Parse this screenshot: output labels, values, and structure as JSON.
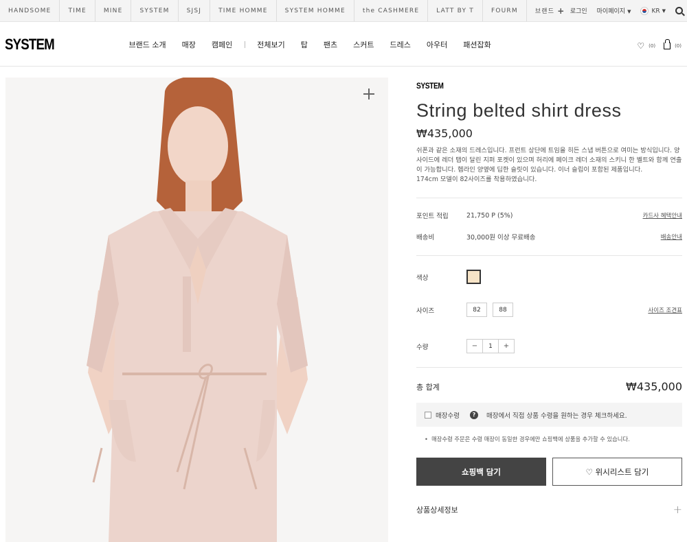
{
  "top_brands": [
    "HANDSOME",
    "TIME",
    "MINE",
    "SYSTEM",
    "SJSJ",
    "TIME HOMME",
    "SYSTEM HOMME",
    "the CASHMERE",
    "LATT BY T",
    "FOURM",
    "브랜드"
  ],
  "util": {
    "login": "로그인",
    "mypage": "마이페이지",
    "lang": "KR"
  },
  "header": {
    "logo": "SYSTEM",
    "nav_group1": [
      "브랜드 소개",
      "매장",
      "캠페인"
    ],
    "nav_group2": [
      "전체보기",
      "탑",
      "팬츠",
      "스커트",
      "드레스",
      "아우터",
      "패션잡화"
    ],
    "wish_count": "(0)",
    "cart_count": "(0)"
  },
  "product": {
    "brand": "SYSTEM",
    "name": "String belted shirt dress",
    "price": "₩435,000",
    "description": "쉬폰과 같은 소재의 드레스입니다. 프런트 상단에 트임을 히든 스냅 버튼으로 여미는 방식입니다. 양 사이드에 레더 탭이 달린 지퍼 포켓이 있으며 허리에 페이크 레더 소재의 스키니 한 벨트와 함께 연출이 가능합니다. 헴라인 양옆에 딥한 슬릿이 있습니다. 이너 슬립이 포함된 제품입니다.",
    "model_note": "174cm 모델이 82사이즈를 착용하였습니다.",
    "points_label": "포인트 적립",
    "points_value": "21,750 P (5%)",
    "points_link": "카드사 혜택안내",
    "shipping_label": "배송비",
    "shipping_value": "30,000원 이상 무료배송",
    "shipping_link": "배송안내",
    "color_label": "색상",
    "color_swatch": "#f7e4c7",
    "size_label": "사이즈",
    "sizes": [
      "82",
      "88"
    ],
    "size_link": "사이즈 조견표",
    "qty_label": "수량",
    "qty_minus": "−",
    "qty_value": "1",
    "qty_plus": "+",
    "total_label": "총 합계",
    "total_value": "₩435,000",
    "store_label": "매장수령",
    "store_help": "?",
    "store_text": "매장에서 직접 상품 수령을 원하는 경우 체크하세요.",
    "store_note": "매장수령 주문은 수령 매장이 동일한 경우에만 쇼핑백에 상품을 추가할 수 있습니다.",
    "cart_button": "쇼핑백 담기",
    "wish_button": "♡ 위시리스트 담기",
    "detail_section": "상품상세정보"
  }
}
